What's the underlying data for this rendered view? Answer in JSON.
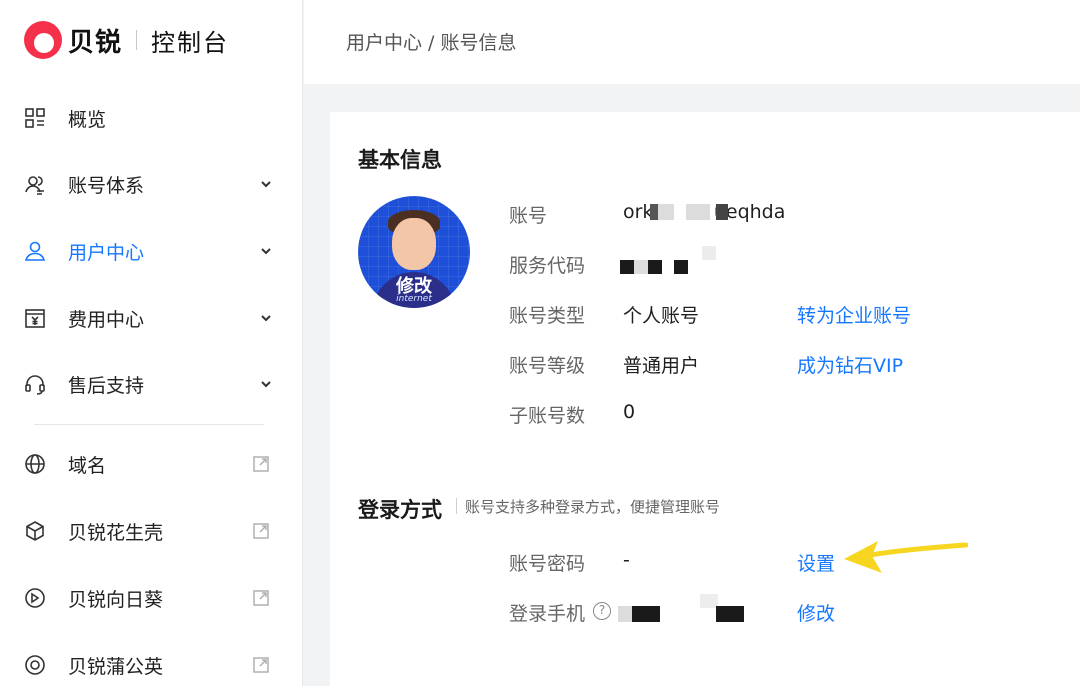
{
  "brand": {
    "name": "贝锐",
    "subtitle": "控制台",
    "colors": {
      "logo": "#f4304a",
      "accent": "#1677ff"
    }
  },
  "sidebar": {
    "items": [
      {
        "label": "概览",
        "icon": "grid-icon",
        "expandable": false,
        "active": false
      },
      {
        "label": "账号体系",
        "icon": "users-icon",
        "expandable": true,
        "active": false
      },
      {
        "label": "用户中心",
        "icon": "user-icon",
        "expandable": true,
        "active": true
      },
      {
        "label": "费用中心",
        "icon": "yen-icon",
        "expandable": true,
        "active": false
      },
      {
        "label": "售后支持",
        "icon": "headset-icon",
        "expandable": true,
        "active": false
      }
    ],
    "links": [
      {
        "label": "域名",
        "icon": "globe-icon",
        "external": true
      },
      {
        "label": "贝锐花生壳",
        "icon": "cube-icon",
        "external": true
      },
      {
        "label": "贝锐向日葵",
        "icon": "sunflower-icon",
        "external": true
      },
      {
        "label": "贝锐蒲公英",
        "icon": "dandelion-icon",
        "external": true
      }
    ]
  },
  "header": {
    "breadcrumb": "用户中心 / 账号信息"
  },
  "basic_info": {
    "title": "基本信息",
    "avatar": {
      "edit_label": "修改",
      "tag": "internet"
    },
    "fields": [
      {
        "label": "账号",
        "value": "ork          ueqhda"
      },
      {
        "label": "服务代码",
        "value": ""
      },
      {
        "label": "账号类型",
        "value": "个人账号",
        "action": "转为企业账号"
      },
      {
        "label": "账号等级",
        "value": "普通用户",
        "action": "成为钻石VIP"
      },
      {
        "label": "子账号数",
        "value": "0"
      }
    ]
  },
  "login_methods": {
    "title": "登录方式",
    "description": "账号支持多种登录方式，便捷管理账号",
    "fields": [
      {
        "label": "账号密码",
        "value": "-",
        "action": "设置"
      },
      {
        "label": "登录手机",
        "value": "",
        "action": "修改",
        "help_icon": "question-circle-icon"
      }
    ]
  },
  "annotation": {
    "arrow_color": "#f7d622"
  }
}
